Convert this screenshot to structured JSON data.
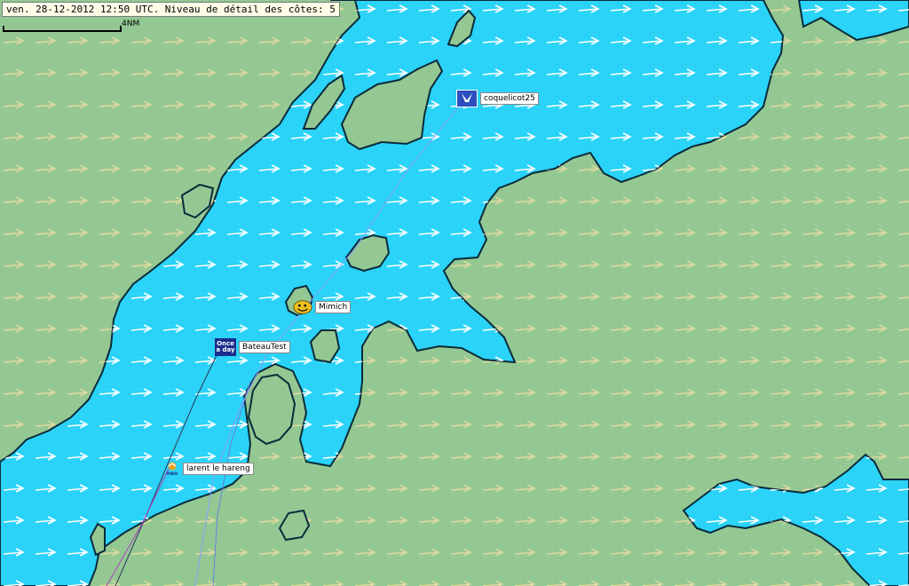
{
  "status": {
    "text": "ven. 28-12-2012 12:50 UTC. Niveau de détail des côtes: 5"
  },
  "scale": {
    "label": "4NM"
  },
  "colors": {
    "water": "#2ad3f7",
    "land": "#93c893",
    "coast": "#0a2a3a",
    "wind_on_water": "#ffffff",
    "wind_on_land": "#e8dca0",
    "track_blue": "#6a7fe0",
    "track_purple": "#b040c0",
    "track_dark": "#30385a"
  },
  "boats": [
    {
      "name": "coquelicot25",
      "icon": "flag-icon",
      "icon_color": "#2c4fbf"
    },
    {
      "name": "Mimich",
      "icon": "smiley-icon",
      "icon_color": "#f0c020"
    },
    {
      "name": "BateauTest",
      "icon": "once-a-day-icon",
      "icon_text": "Once a day",
      "icon_color": "#1a2d8c"
    },
    {
      "name": "larent le hareng",
      "icon": "sponsor-icon",
      "icon_text": "neo",
      "icon_color": "#f0a020"
    }
  ],
  "wind": {
    "direction": "east",
    "icon": "wind-arrow-icon"
  }
}
